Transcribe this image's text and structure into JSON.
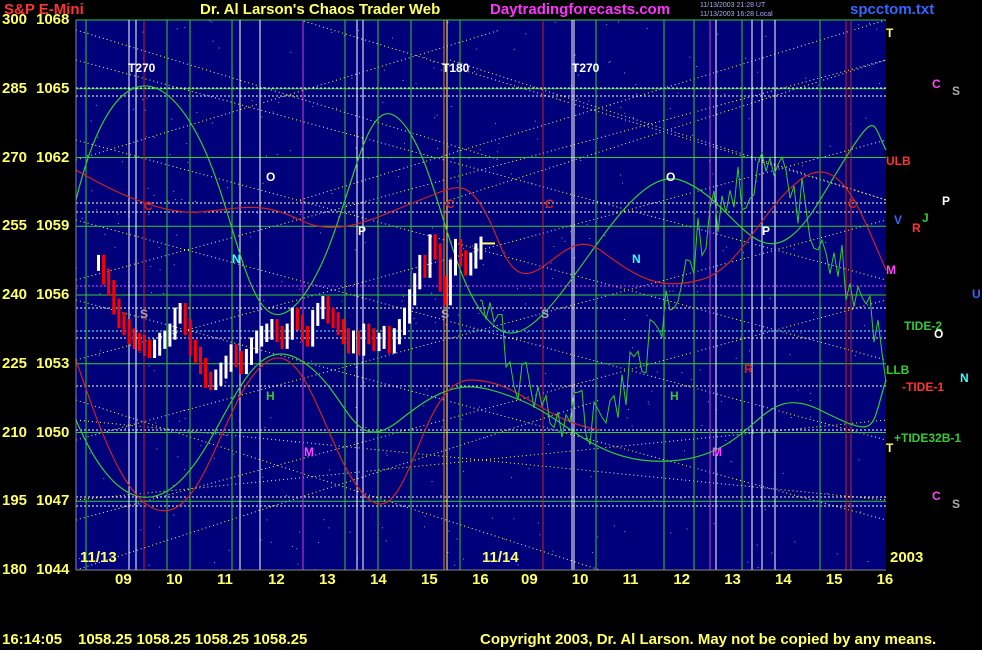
{
  "header": {
    "symbol": "S&P E-Mini",
    "title": "Dr. Al Larson's Chaos Trader Web",
    "site": "Daytradingforecasts.com",
    "stamp1": "11/13/2003 21:28 UT",
    "stamp2": "11/13/2003 16:28 Local",
    "file": "spcctom.txt"
  },
  "footer": {
    "time": "16:14:05",
    "quote": "1058.25 1058.25 1058.25 1058.25",
    "copyright": "Copyright 2003, Dr. Al Larson. May not be copied by any means."
  },
  "colors": {
    "background": "#00007a",
    "price_up": "#ffffff",
    "price_down": "#ff0000",
    "grid_yellow": "#ffff66",
    "green": "#33cc33",
    "red": "#cc2222"
  },
  "chart_data": {
    "type": "line",
    "y_left_ticks": [
      "300",
      "285",
      "270",
      "255",
      "240",
      "225",
      "210",
      "195",
      "180"
    ],
    "y_right_ticks": [
      "1068",
      "1065",
      "1062",
      "1059",
      "1056",
      "1053",
      "1050",
      "1047",
      "1044"
    ],
    "ylim": [
      1044,
      1068
    ],
    "x_tick_labels": [
      "09",
      "10",
      "11",
      "12",
      "13",
      "14",
      "15",
      "16",
      "09",
      "10",
      "11",
      "12",
      "13",
      "14",
      "15",
      "16"
    ],
    "date_labels": [
      "11/13",
      "11/14"
    ],
    "year_label": "2003",
    "cycle_labels": [
      "T270",
      "T180",
      "T270"
    ],
    "right_labels": [
      "T",
      "C",
      "S",
      "ULB",
      "V",
      "J",
      "P",
      "R",
      "M",
      "U",
      "TIDE-2",
      "O",
      "LLB",
      "-TIDE-1",
      "N",
      "+TIDE32B-1",
      "T",
      "C",
      "S"
    ],
    "marker_labels": [
      "C",
      "O",
      "N",
      "P",
      "S",
      "H",
      "M",
      "C",
      "S",
      "C",
      "O",
      "N",
      "H",
      "R",
      "P",
      "M",
      "S",
      "C"
    ],
    "price_series": {
      "name": "price",
      "x_hours": [
        8.5,
        8.6,
        8.7,
        8.8,
        8.9,
        9.0,
        9.1,
        9.2,
        9.3,
        9.4,
        9.5,
        9.6,
        9.7,
        9.8,
        9.9,
        10.0,
        10.1,
        10.2,
        10.3,
        10.4,
        10.5,
        10.6,
        10.7,
        10.8,
        10.9,
        11.0,
        11.1,
        11.2,
        11.3,
        11.4,
        11.5,
        11.6,
        11.7,
        11.8,
        11.9,
        12.0,
        12.1,
        12.2,
        12.3,
        12.4,
        12.5,
        12.6,
        12.7,
        12.8,
        12.9,
        13.0,
        13.1,
        13.2,
        13.3,
        13.4,
        13.5,
        13.6,
        13.7,
        13.8,
        13.9,
        14.0,
        14.1,
        14.2,
        14.3,
        14.4,
        14.5,
        14.6,
        14.7,
        14.8,
        14.9,
        15.0,
        15.1,
        15.2,
        15.3,
        15.4,
        15.5,
        15.6,
        15.7,
        15.8,
        15.9,
        16.0
      ],
      "values": [
        1057.4,
        1056.8,
        1056.3,
        1055.5,
        1054.9,
        1054.6,
        1054.2,
        1054.0,
        1053.9,
        1053.7,
        1053.6,
        1053.7,
        1054.0,
        1054.1,
        1054.4,
        1055.1,
        1055.3,
        1054.6,
        1053.7,
        1053.4,
        1052.9,
        1052.3,
        1052.2,
        1052.4,
        1052.7,
        1053.0,
        1053.5,
        1053.2,
        1052.9,
        1053.3,
        1053.8,
        1054.1,
        1054.3,
        1054.4,
        1054.6,
        1054.3,
        1054.0,
        1054.4,
        1055.1,
        1054.8,
        1054.3,
        1054.1,
        1055.0,
        1055.3,
        1055.6,
        1055.1,
        1054.9,
        1054.6,
        1054.2,
        1053.8,
        1054.1,
        1053.7,
        1054.4,
        1054.2,
        1053.9,
        1054.0,
        1054.3,
        1053.8,
        1054.2,
        1054.6,
        1055.1,
        1055.9,
        1056.6,
        1057.4,
        1057.1,
        1058.3,
        1057.9,
        1056.5,
        1055.9,
        1057.2,
        1058.1,
        1057.6,
        1057.2,
        1057.5,
        1057.9,
        1058.2
      ]
    },
    "last_value": 1058.25
  }
}
